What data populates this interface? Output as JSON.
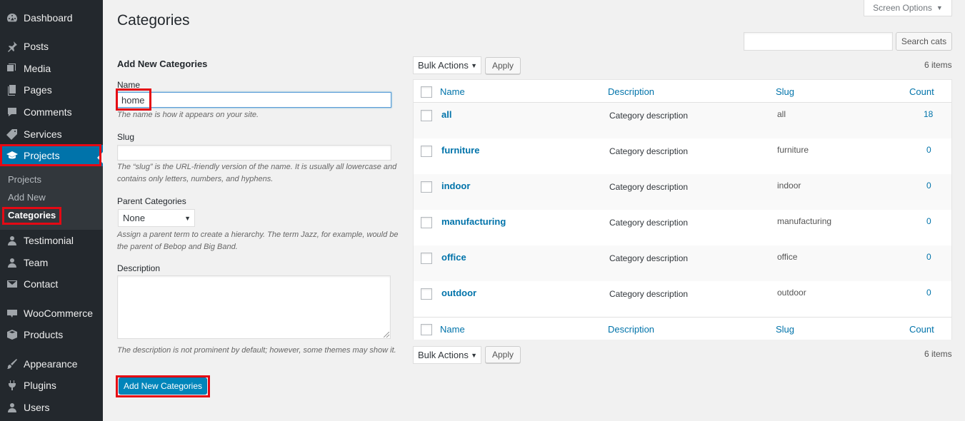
{
  "sidebar": {
    "items": [
      {
        "label": "Dashboard",
        "icon": "dashboard-icon"
      },
      {
        "label": "Posts",
        "icon": "pin-icon"
      },
      {
        "label": "Media",
        "icon": "media-icon"
      },
      {
        "label": "Pages",
        "icon": "pages-icon"
      },
      {
        "label": "Comments",
        "icon": "comments-icon"
      },
      {
        "label": "Services",
        "icon": "tag-icon"
      },
      {
        "label": "Projects",
        "icon": "graduation-cap-icon"
      },
      {
        "label": "Testimonial",
        "icon": "user-icon"
      },
      {
        "label": "Team",
        "icon": "user-icon"
      },
      {
        "label": "Contact",
        "icon": "envelope-icon"
      },
      {
        "label": "WooCommerce",
        "icon": "woocommerce-icon"
      },
      {
        "label": "Products",
        "icon": "box-icon"
      },
      {
        "label": "Appearance",
        "icon": "brush-icon"
      },
      {
        "label": "Plugins",
        "icon": "plug-icon"
      },
      {
        "label": "Users",
        "icon": "user-icon"
      }
    ],
    "submenu": [
      "Projects",
      "Add New",
      "Categories"
    ]
  },
  "header": {
    "title": "Categories",
    "screen_options": "Screen Options",
    "search_button": "Search cats",
    "search_value": ""
  },
  "form": {
    "heading": "Add New Categories",
    "name_label": "Name",
    "name_value": "home",
    "name_help": "The name is how it appears on your site.",
    "slug_label": "Slug",
    "slug_value": "",
    "slug_help": "The “slug” is the URL-friendly version of the name. It is usually all lowercase and contains only letters, numbers, and hyphens.",
    "parent_label": "Parent Categories",
    "parent_value": "None",
    "parent_help": "Assign a parent term to create a hierarchy. The term Jazz, for example, would be the parent of Bebop and Big Band.",
    "description_label": "Description",
    "description_help": "The description is not prominent by default; however, some themes may show it.",
    "submit": "Add New Categories"
  },
  "table": {
    "bulk_actions": "Bulk Actions",
    "apply": "Apply",
    "items_count": "6 items",
    "columns": [
      "Name",
      "Description",
      "Slug",
      "Count"
    ],
    "rows": [
      {
        "name": "all",
        "description": "Category description",
        "slug": "all",
        "count": "18"
      },
      {
        "name": "furniture",
        "description": "Category description",
        "slug": "furniture",
        "count": "0"
      },
      {
        "name": "indoor",
        "description": "Category description",
        "slug": "indoor",
        "count": "0"
      },
      {
        "name": "manufacturing",
        "description": "Category description",
        "slug": "manufacturing",
        "count": "0"
      },
      {
        "name": "office",
        "description": "Category description",
        "slug": "office",
        "count": "0"
      },
      {
        "name": "outdoor",
        "description": "Category description",
        "slug": "outdoor",
        "count": "0"
      }
    ]
  },
  "colors": {
    "sidebar_bg": "#23282d",
    "submenu_bg": "#32373c",
    "accent": "#0073aa",
    "primary_button": "#0085ba",
    "highlight": "#e50914"
  }
}
